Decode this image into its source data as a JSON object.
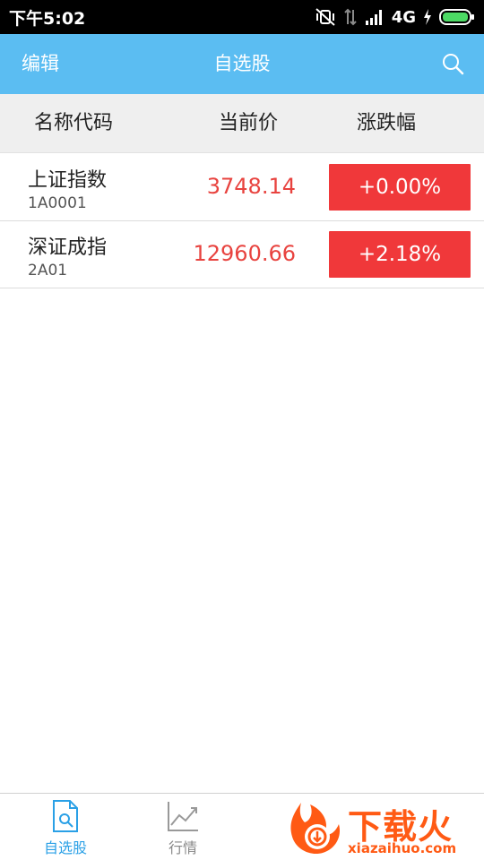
{
  "status_bar": {
    "time": "下午5:02",
    "network": "4G",
    "icons": [
      "mute-vibrate-icon",
      "data-arrows-icon",
      "signal-icon",
      "charging-icon",
      "battery-icon"
    ],
    "battery_color": "#4cd964"
  },
  "header": {
    "edit_label": "编辑",
    "title": "自选股",
    "search_icon": "search-icon",
    "background": "#5bbdf2"
  },
  "columns": {
    "name": "名称代码",
    "price": "当前价",
    "change": "涨跌幅"
  },
  "stocks": [
    {
      "name": "上证指数",
      "code": "1A0001",
      "price": "3748.14",
      "change": "+0.00%"
    },
    {
      "name": "深证成指",
      "code": "2A01",
      "price": "12960.66",
      "change": "+2.18%"
    }
  ],
  "colors": {
    "price_up": "#e8433f",
    "change_badge": "#f0383a",
    "nav_active": "#2aa0e6",
    "nav_inactive": "#888888"
  },
  "bottom_nav": {
    "items": [
      {
        "label": "自选股",
        "icon": "watchlist-doc-icon",
        "active": true
      },
      {
        "label": "行情",
        "icon": "chart-trend-icon",
        "active": false
      }
    ]
  },
  "watermark": {
    "title": "下载火",
    "domain": "xiazaihuo.com",
    "color": "#ff5a14"
  }
}
